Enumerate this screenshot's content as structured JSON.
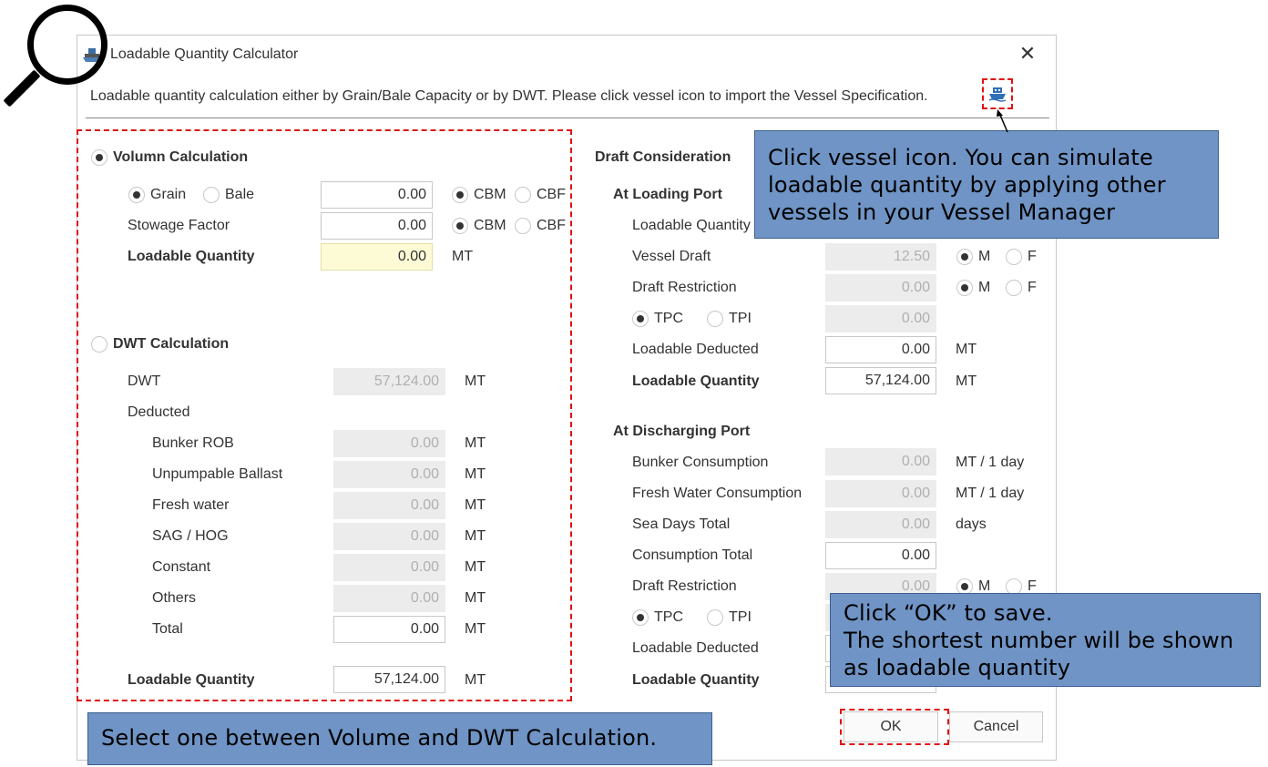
{
  "window": {
    "title": "Loadable Quantity Calculator",
    "close_icon": "close-icon",
    "description": "Loadable quantity calculation either by Grain/Bale Capacity or by DWT. Please click vessel icon to import the Vessel Specification.",
    "vessel_icon": "ship-icon"
  },
  "volume": {
    "title": "Volumn Calculation",
    "selected": true,
    "grain_label": "Grain",
    "bale_label": "Bale",
    "capacity_value": "0.00",
    "cbm_label": "CBM",
    "cbf_label": "CBF",
    "stowage_label": "Stowage Factor",
    "stowage_value": "0.00",
    "loadable_label": "Loadable Quantity",
    "loadable_value": "0.00",
    "unit": "MT"
  },
  "dwt": {
    "title": "DWT Calculation",
    "selected": false,
    "dwt_label": "DWT",
    "dwt_value": "57,124.00",
    "deducted_label": "Deducted",
    "rows": [
      {
        "label": "Bunker ROB",
        "value": "0.00"
      },
      {
        "label": "Unpumpable Ballast",
        "value": "0.00"
      },
      {
        "label": "Fresh water",
        "value": "0.00"
      },
      {
        "label": "SAG / HOG",
        "value": "0.00"
      },
      {
        "label": "Constant",
        "value": "0.00"
      },
      {
        "label": "Others",
        "value": "0.00"
      },
      {
        "label": "Total",
        "value": "0.00"
      }
    ],
    "loadable_label": "Loadable Quantity",
    "loadable_value": "57,124.00",
    "unit": "MT"
  },
  "draft": {
    "title": "Draft Consideration",
    "loading": {
      "title": "At Loading Port",
      "loadable_qty_label": "Loadable Quantity",
      "vessel_draft_label": "Vessel Draft",
      "vessel_draft_value": "12.50",
      "draft_restriction_label": "Draft Restriction",
      "draft_restriction_value": "0.00",
      "tpc_label": "TPC",
      "tpi_label": "TPI",
      "tpc_value": "0.00",
      "loadable_deducted_label": "Loadable Deducted",
      "loadable_deducted_value": "0.00",
      "loadable_label": "Loadable Quantity",
      "loadable_value": "57,124.00",
      "m_label": "M",
      "f_label": "F",
      "unit": "MT"
    },
    "discharging": {
      "title": "At Discharging Port",
      "bunker_label": "Bunker Consumption",
      "bunker_value": "0.00",
      "bunker_unit": "MT / 1 day",
      "fresh_label": "Fresh Water Consumption",
      "fresh_value": "0.00",
      "fresh_unit": "MT / 1 day",
      "sea_days_label": "Sea Days Total",
      "sea_days_value": "0.00",
      "sea_days_unit": "days",
      "consumption_label": "Consumption Total",
      "consumption_value": "0.00",
      "draft_restriction_label": "Draft Restriction",
      "draft_restriction_value": "0.00",
      "tpc_label": "TPC",
      "tpi_label": "TPI",
      "loadable_deducted_label": "Loadable Deducted",
      "loadable_label": "Loadable Quantity",
      "m_label": "M",
      "f_label": "F"
    }
  },
  "buttons": {
    "ok": "OK",
    "cancel": "Cancel"
  },
  "callouts": {
    "vessel": [
      "Click vessel icon. You can simulate",
      "loadable quantity by applying other",
      "vessels in your Vessel Manager"
    ],
    "ok": [
      "Click “OK” to save.",
      "The shortest number will be shown",
      "as loadable quantity"
    ],
    "select": [
      "Select one between Volume and DWT Calculation."
    ]
  },
  "colors": {
    "callout_bg": "#6f94c5",
    "highlight_dash": "#e01010",
    "loadable_field_bg": "#fdfbd6",
    "disabled_field_bg": "#ececec"
  },
  "magnifier_icon": "magnifier-icon"
}
